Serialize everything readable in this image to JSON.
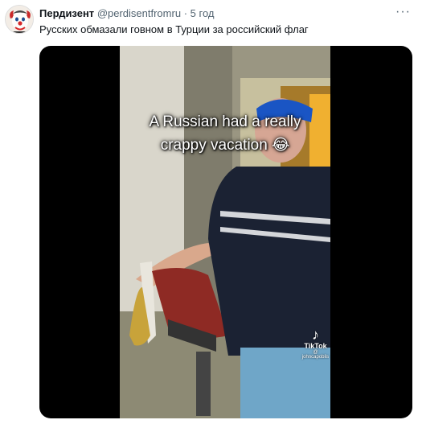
{
  "tweet": {
    "author_name": "Пердизент",
    "handle": "@perdisentfromru",
    "separator": "·",
    "time": "5 год",
    "more_label": "···",
    "text": "Русских обмазали говном в Турции за российский флаг"
  },
  "media": {
    "caption_line1": "A Russian had a really",
    "caption_line2": "crappy vacation 😂",
    "watermark_brand": "TikTok",
    "watermark_user": "@ johncapoblis"
  }
}
